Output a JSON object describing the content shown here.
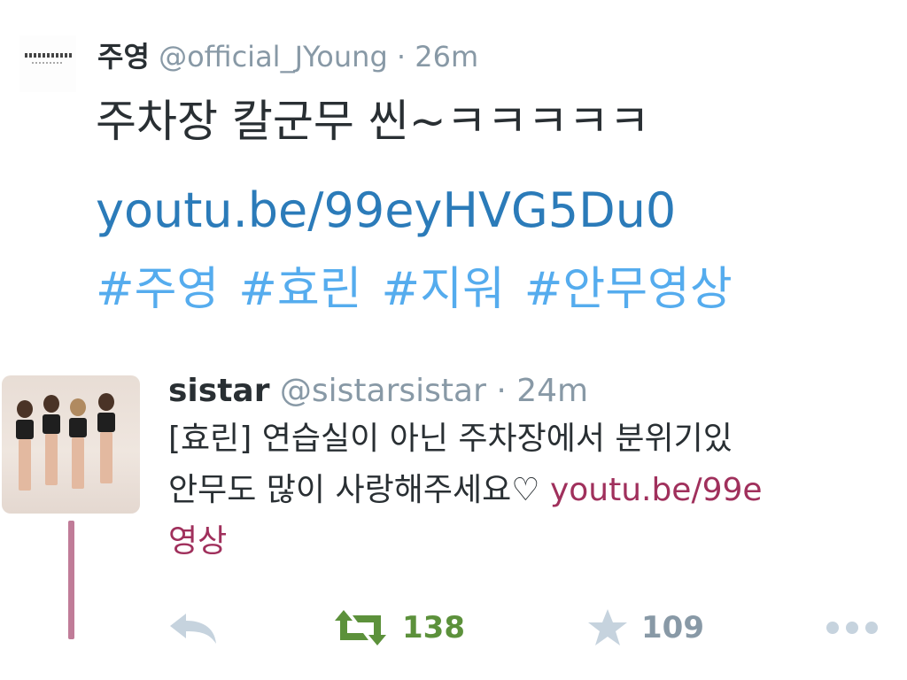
{
  "tweet1": {
    "name": "주영",
    "handle": "@official_JYoung",
    "separator": "·",
    "time": "26m",
    "text": "주차장 칼군무 씬~ㅋㅋㅋㅋㅋ",
    "link": "youtu.be/99eyHVG5Du0",
    "hashtags": [
      "#주영",
      "#효린",
      "#지워",
      "#안무영상"
    ],
    "avatar_icon": "jyoung-logo-avatar"
  },
  "tweet2": {
    "name": "sistar",
    "handle": "@sistarsistar",
    "separator": "·",
    "time": "24m",
    "line1": "[효린] 연습실이 아닌 주차장에서 분위기있",
    "line2_text": "안무도 많이 사랑해주세요♡ ",
    "line2_link": "youtu.be/99e",
    "line3": "영상",
    "avatar_icon": "sistar-group-photo-avatar",
    "actions": {
      "reply_icon": "reply-icon",
      "retweet_icon": "retweet-icon",
      "retweet_count": "138",
      "favorite_icon": "star-icon",
      "favorite_count": "109",
      "more_icon": "more-dots-icon"
    }
  },
  "colors": {
    "link": "#2b7bb9",
    "hashtag": "#55acee",
    "sistar_link": "#a0305c",
    "retweet_green": "#5c913b",
    "muted_gray": "#8899a6",
    "thread_line": "#c07c98"
  }
}
